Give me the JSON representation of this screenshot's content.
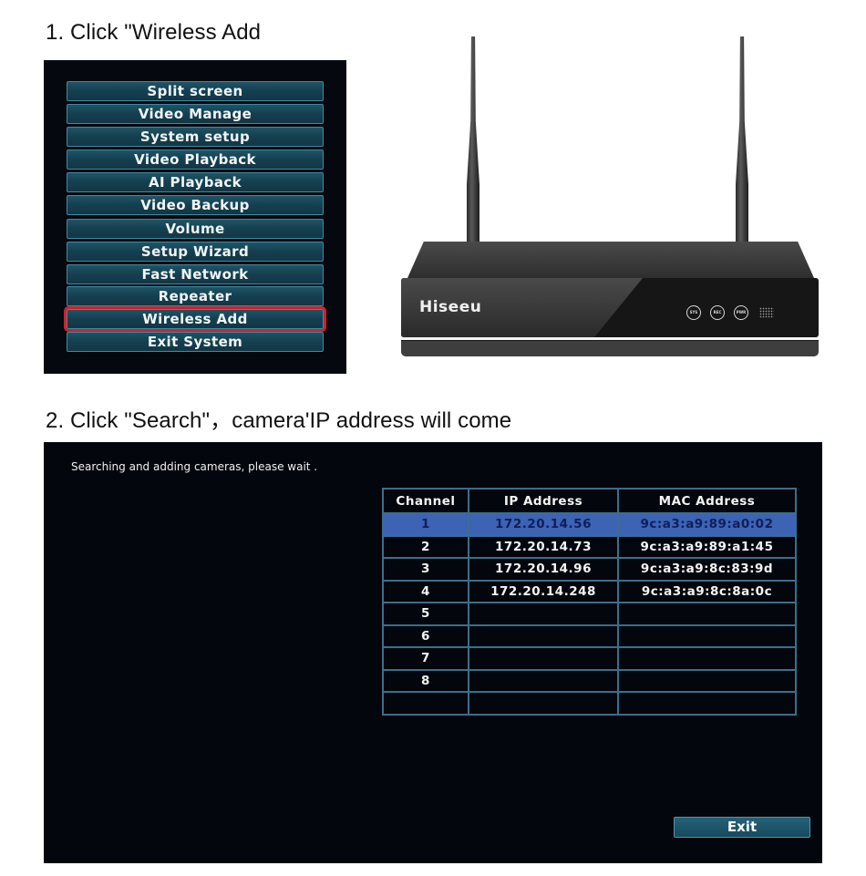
{
  "steps": [
    {
      "title": "1. Click \"Wireless Add"
    },
    {
      "title": "2. Click \"Search\"，camera'IP address will come"
    }
  ],
  "menu": {
    "items": [
      {
        "label": "Split screen"
      },
      {
        "label": "Video Manage"
      },
      {
        "label": "System setup"
      },
      {
        "label": "Video Playback"
      },
      {
        "label": "AI Playback"
      },
      {
        "label": "Video Backup"
      },
      {
        "label": "Volume"
      },
      {
        "label": "Setup Wizard"
      },
      {
        "label": "Fast Network"
      },
      {
        "label": "Repeater"
      },
      {
        "label": "Wireless Add",
        "highlighted": true
      },
      {
        "label": "Exit System"
      }
    ],
    "highlight_color": "#d2202a"
  },
  "device": {
    "brand": "Hiseeu",
    "leds": [
      "SYS",
      "REC",
      "PWR"
    ]
  },
  "search": {
    "status": "Searching and adding cameras, please wait .",
    "columns": [
      "Channel",
      "IP Address",
      "MAC Address"
    ],
    "rows": [
      {
        "channel": "1",
        "ip": "172.20.14.56",
        "mac": "9c:a3:a9:89:a0:02",
        "selected": true
      },
      {
        "channel": "2",
        "ip": "172.20.14.73",
        "mac": "9c:a3:a9:89:a1:45"
      },
      {
        "channel": "3",
        "ip": "172.20.14.96",
        "mac": "9c:a3:a9:8c:83:9d"
      },
      {
        "channel": "4",
        "ip": "172.20.14.248",
        "mac": "9c:a3:a9:8c:8a:0c"
      },
      {
        "channel": "5",
        "ip": "",
        "mac": ""
      },
      {
        "channel": "6",
        "ip": "",
        "mac": ""
      },
      {
        "channel": "7",
        "ip": "",
        "mac": ""
      },
      {
        "channel": "8",
        "ip": "",
        "mac": ""
      },
      {
        "channel": "",
        "ip": "",
        "mac": ""
      }
    ],
    "exit_label": "Exit",
    "selected_row_color": "#3c63b4"
  }
}
